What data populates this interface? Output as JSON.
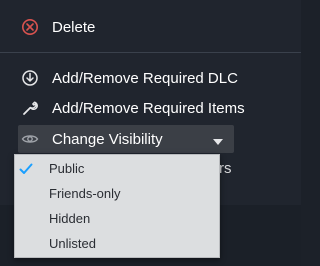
{
  "menu": {
    "delete_label": "Delete",
    "items": [
      {
        "label": "Add/Remove Required DLC",
        "icon": "dlc-icon"
      },
      {
        "label": "Add/Remove Required Items",
        "icon": "wrench-icon"
      }
    ],
    "visibility": {
      "label": "Change Visibility",
      "icon": "eye-icon",
      "selected": "Public",
      "options": [
        "Public",
        "Friends-only",
        "Hidden",
        "Unlisted"
      ]
    },
    "obscured_text_fragment": "rs"
  },
  "colors": {
    "menu_bg": "#20252e",
    "highlight_bg": "#3b3f46",
    "dropdown_bg": "#dcdee0",
    "check_color": "#1a9fff",
    "delete_icon_color": "#d9534f"
  }
}
